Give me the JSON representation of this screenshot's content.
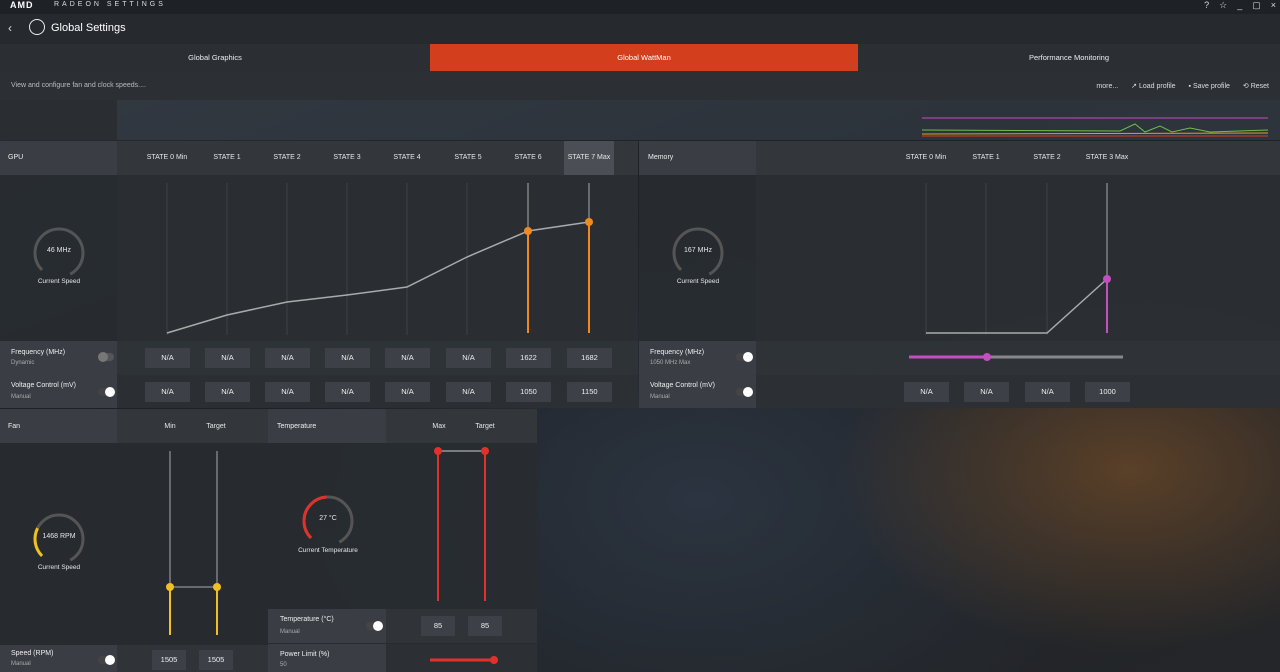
{
  "app": {
    "brand": "AMD",
    "name": "RADEON SETTINGS"
  },
  "header": {
    "title": "Global Settings"
  },
  "tabs": [
    {
      "label": "Global Graphics"
    },
    {
      "label": "Global WattMan",
      "active": true
    },
    {
      "label": "Performance Monitoring"
    }
  ],
  "subbar": {
    "description": "View and configure fan and clock speeds....",
    "more": "more...",
    "load": "Load profile",
    "save": "Save profile",
    "reset": "Reset"
  },
  "gpu": {
    "title": "GPU",
    "states": [
      "STATE 0 Min",
      "STATE 1",
      "STATE 2",
      "STATE 3",
      "STATE 4",
      "STATE 5",
      "STATE 6",
      "STATE 7 Max"
    ],
    "gauge_value": "46 MHz",
    "gauge_label": "Current Speed",
    "frequency": {
      "label": "Frequency (MHz)",
      "mode": "Dynamic",
      "values": [
        "N/A",
        "N/A",
        "N/A",
        "N/A",
        "N/A",
        "N/A",
        "1622",
        "1682"
      ]
    },
    "voltage": {
      "label": "Voltage Control (mV)",
      "mode": "Manual",
      "values": [
        "N/A",
        "N/A",
        "N/A",
        "N/A",
        "N/A",
        "N/A",
        "1050",
        "1150"
      ]
    }
  },
  "memory": {
    "title": "Memory",
    "states": [
      "STATE 0 Min",
      "STATE 1",
      "STATE 2",
      "STATE 3 Max"
    ],
    "gauge_value": "167 MHz",
    "gauge_label": "Current Speed",
    "frequency": {
      "label": "Frequency (MHz)",
      "mode": "1050 MHz Max"
    },
    "voltage": {
      "label": "Voltage Control (mV)",
      "mode": "Manual",
      "values": [
        "N/A",
        "N/A",
        "N/A",
        "1000"
      ]
    }
  },
  "fan": {
    "title": "Fan",
    "cols": [
      "Min",
      "Target"
    ],
    "gauge_value": "1468 RPM",
    "gauge_label": "Current Speed",
    "speed_label": "Speed (RPM)",
    "speed_mode": "Manual",
    "values": [
      "1505",
      "1505"
    ]
  },
  "temperature": {
    "title": "Temperature",
    "cols": [
      "Max",
      "Target"
    ],
    "gauge_value": "27 °C",
    "gauge_label": "Current Temperature",
    "temp_label": "Temperature (°C)",
    "temp_mode": "Manual",
    "values": [
      "85",
      "85"
    ],
    "power_label": "Power Limit (%)",
    "power_mode": "50"
  },
  "colors": {
    "accent": "#d33e1d",
    "gpu_curve": "#f08a1c",
    "mem_curve": "#c44fc0",
    "fan_curve": "#f0c020",
    "temp_curve": "#e0322a"
  }
}
